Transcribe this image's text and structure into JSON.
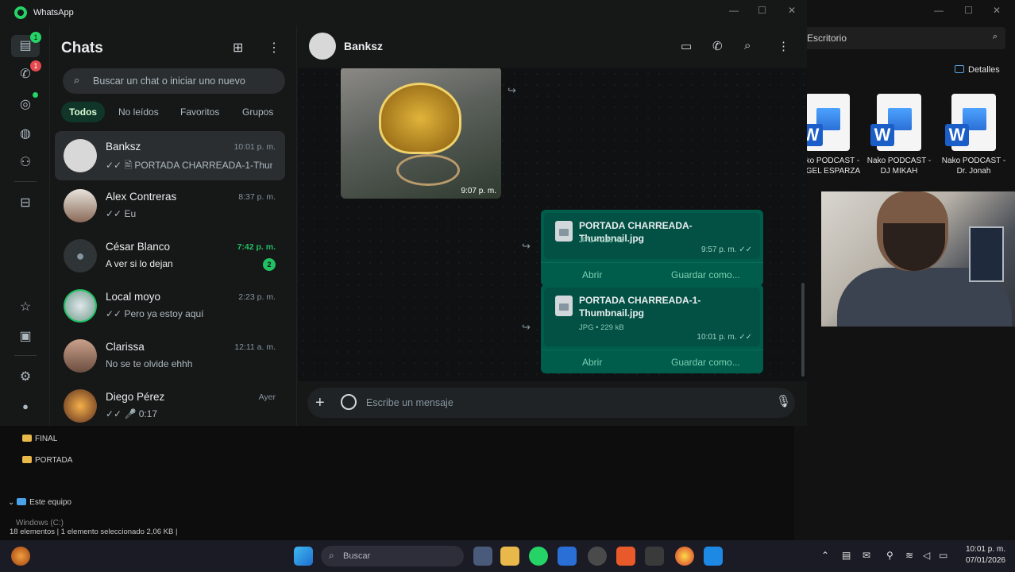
{
  "window": {
    "app_title": "WhatsApp"
  },
  "rail": {
    "chats_badge": "1",
    "calls_badge": "1"
  },
  "chatlist": {
    "title": "Chats",
    "search_placeholder": "Buscar un chat o iniciar uno nuevo",
    "filters": [
      "Todos",
      "No leídos",
      "Favoritos",
      "Grupos"
    ],
    "rows": [
      {
        "name": "Banksz",
        "time": "10:01 p. m.",
        "preview": "✓✓ 🗎 PORTADA CHARREADA-1-Thumb...",
        "unread": ""
      },
      {
        "name": "Alex Contreras",
        "time": "8:37 p. m.",
        "preview": "✓✓ Eu",
        "unread": ""
      },
      {
        "name": "César Blanco",
        "time": "7:42 p. m.",
        "preview": "A ver si lo dejan",
        "unread": "2"
      },
      {
        "name": "Local moyo",
        "time": "2:23 p. m.",
        "preview": "✓✓ Pero ya estoy aquí",
        "unread": ""
      },
      {
        "name": "Clarissa",
        "time": "12:11 a. m.",
        "preview": "No se te olvide ehhh",
        "unread": ""
      },
      {
        "name": "Diego Pérez",
        "time": "Ayer",
        "preview": "✓✓ 🎤 0:17",
        "unread": ""
      }
    ]
  },
  "conversation": {
    "contact": "Banksz",
    "image_time": "9:07 p. m.",
    "docs": [
      {
        "name": "PORTADA CHARREADA-Thumbnail.jpg",
        "meta": "JPG • 226 kB",
        "time": "9:57 p. m. ✓✓",
        "open": "Abrir",
        "save": "Guardar como..."
      },
      {
        "name": "PORTADA CHARREADA-1-Thumbnail.jpg",
        "meta": "JPG • 229 kB",
        "time": "10:01 p. m. ✓✓",
        "open": "Abrir",
        "save": "Guardar como..."
      }
    ],
    "composer_placeholder": "Escribe un mensaje"
  },
  "explorer": {
    "address": "Escritorio",
    "details": "Detalles",
    "files": [
      {
        "label": "Nako PODCAST - ÁNGEL ESPARZA"
      },
      {
        "label": "Nako PODCAST - DJ MIKAH"
      },
      {
        "label": "Nako PODCAST - Dr. Jonah"
      }
    ],
    "tree": [
      "FINAL",
      "PORTADA",
      "Este equipo",
      "Windows (C:)"
    ],
    "status": "18 elementos  |  1 elemento seleccionado  2,06 KB  |"
  },
  "taskbar": {
    "search": "Buscar",
    "clock_time": "10:01 p. m.",
    "clock_date": "07/01/2026"
  }
}
